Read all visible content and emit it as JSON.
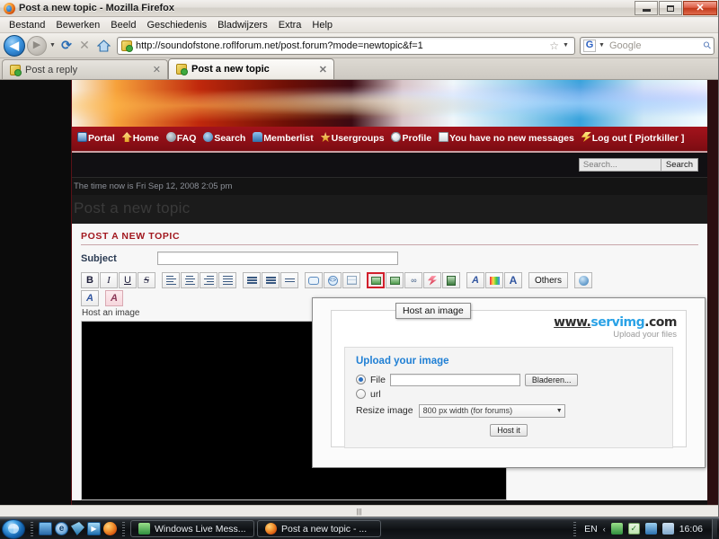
{
  "window": {
    "title": "Post a new topic - Mozilla Firefox",
    "app_icon": "firefox-icon",
    "minimize": "–",
    "maximize": "□",
    "close": "✕"
  },
  "menu": {
    "items": [
      "Bestand",
      "Bewerken",
      "Beeld",
      "Geschiedenis",
      "Bladwijzers",
      "Extra",
      "Help"
    ]
  },
  "navbar": {
    "back": "◀",
    "forward": "▶",
    "dropdown_caret": "▼",
    "reload": "⟳",
    "stop": "✕",
    "home": "⌂",
    "url": "http://soundofstone.roflforum.net/post.forum?mode=newtopic&f=1",
    "bookmark_star": "☆",
    "search_engine": "G",
    "search_placeholder": "Google",
    "search_go": "⚲"
  },
  "tabs": [
    {
      "label": "Post a reply",
      "close": "✕",
      "active": false
    },
    {
      "label": "Post a new topic",
      "close": "✕",
      "active": true
    }
  ],
  "forum": {
    "nav": [
      {
        "label": "Portal",
        "icon": "portal-icon"
      },
      {
        "label": "Home",
        "icon": "home-icon"
      },
      {
        "label": "FAQ",
        "icon": "faq-icon"
      },
      {
        "label": "Search",
        "icon": "search-icon"
      },
      {
        "label": "Memberlist",
        "icon": "memberlist-icon"
      },
      {
        "label": "Usergroups",
        "icon": "usergroups-icon"
      },
      {
        "label": "Profile",
        "icon": "profile-icon"
      },
      {
        "label": "You have no new messages",
        "icon": "messages-icon"
      },
      {
        "label": "Log out [ Pjotrkiller ]",
        "icon": "logout-icon"
      }
    ],
    "search_placeholder": "Search...",
    "search_button": "Search",
    "time_now": "The time now is Fri Sep 12, 2008 2:05 pm",
    "page_heading": "Post a new topic"
  },
  "post_form": {
    "panel_title": "POST A NEW TOPIC",
    "subject_label": "Subject",
    "subject_value": "",
    "host_an_image_label": "Host an image",
    "toolbar_row1": [
      {
        "name": "bold-button",
        "glyph": "B"
      },
      {
        "name": "italic-button",
        "glyph": "I"
      },
      {
        "name": "underline-button",
        "glyph": "U"
      },
      {
        "name": "strikethrough-button",
        "glyph": "S"
      },
      {
        "name": "align-left-button",
        "glyph": ""
      },
      {
        "name": "align-center-button",
        "glyph": ""
      },
      {
        "name": "align-right-button",
        "glyph": ""
      },
      {
        "name": "align-justify-button",
        "glyph": ""
      },
      {
        "name": "bullet-list-button",
        "glyph": ""
      },
      {
        "name": "numbered-list-button",
        "glyph": ""
      },
      {
        "name": "indent-button",
        "glyph": ""
      },
      {
        "name": "quote-button",
        "glyph": ""
      },
      {
        "name": "code-button",
        "glyph": ""
      },
      {
        "name": "table-button",
        "glyph": ""
      },
      {
        "name": "insert-image-button",
        "glyph": ""
      },
      {
        "name": "image-gallery-button",
        "glyph": ""
      },
      {
        "name": "link-button",
        "glyph": "∞"
      },
      {
        "name": "flash-button",
        "glyph": ""
      },
      {
        "name": "media-button",
        "glyph": ""
      },
      {
        "name": "font-button",
        "glyph": "A"
      },
      {
        "name": "font-color-button",
        "glyph": ""
      },
      {
        "name": "font-size-button",
        "glyph": "A"
      },
      {
        "name": "others-button",
        "glyph": "Others"
      },
      {
        "name": "help-button",
        "glyph": ""
      }
    ],
    "toolbar_row2": [
      {
        "name": "text-effect-button",
        "glyph": "A"
      },
      {
        "name": "text-highlight-button",
        "glyph": "A"
      }
    ],
    "others_label": "Others",
    "message_value": ""
  },
  "smilies": [
    "skull-smiley",
    "star-smiley",
    "cool-smiley",
    "heart-smiley",
    "green-smiley",
    "yellow-smiley",
    "surprised-smiley",
    "blank-smiley"
  ],
  "popup": {
    "tooltip": "Host an image",
    "logo_www": "www.",
    "logo_name": "servimg",
    "logo_com": ".com",
    "logo_tagline": "Upload your files",
    "upload_title": "Upload your image",
    "file_label": "File",
    "file_value": "",
    "browse_button": "Bladeren...",
    "url_label": "url",
    "resize_label": "Resize image",
    "resize_selected": "800 px width (for forums)",
    "resize_caret": "▼",
    "host_button": "Host it"
  },
  "taskbar": {
    "start": "start-orb",
    "quicklaunch": [
      "show-desktop-icon",
      "internet-explorer-icon",
      "messenger-icon",
      "windows-media-player-icon",
      "firefox-icon"
    ],
    "buttons": [
      {
        "label": "Windows Live Mess...",
        "icon": "messenger-icon"
      },
      {
        "label": "Post a new topic - ...",
        "icon": "firefox-icon"
      }
    ],
    "tray": {
      "language": "EN",
      "arrow": "‹",
      "icons": [
        "messenger-tray-icon",
        "security-tray-icon",
        "network-tray-icon",
        "volume-tray-icon"
      ],
      "clock": "16:06"
    }
  },
  "scrollbar_hint": "|||"
}
